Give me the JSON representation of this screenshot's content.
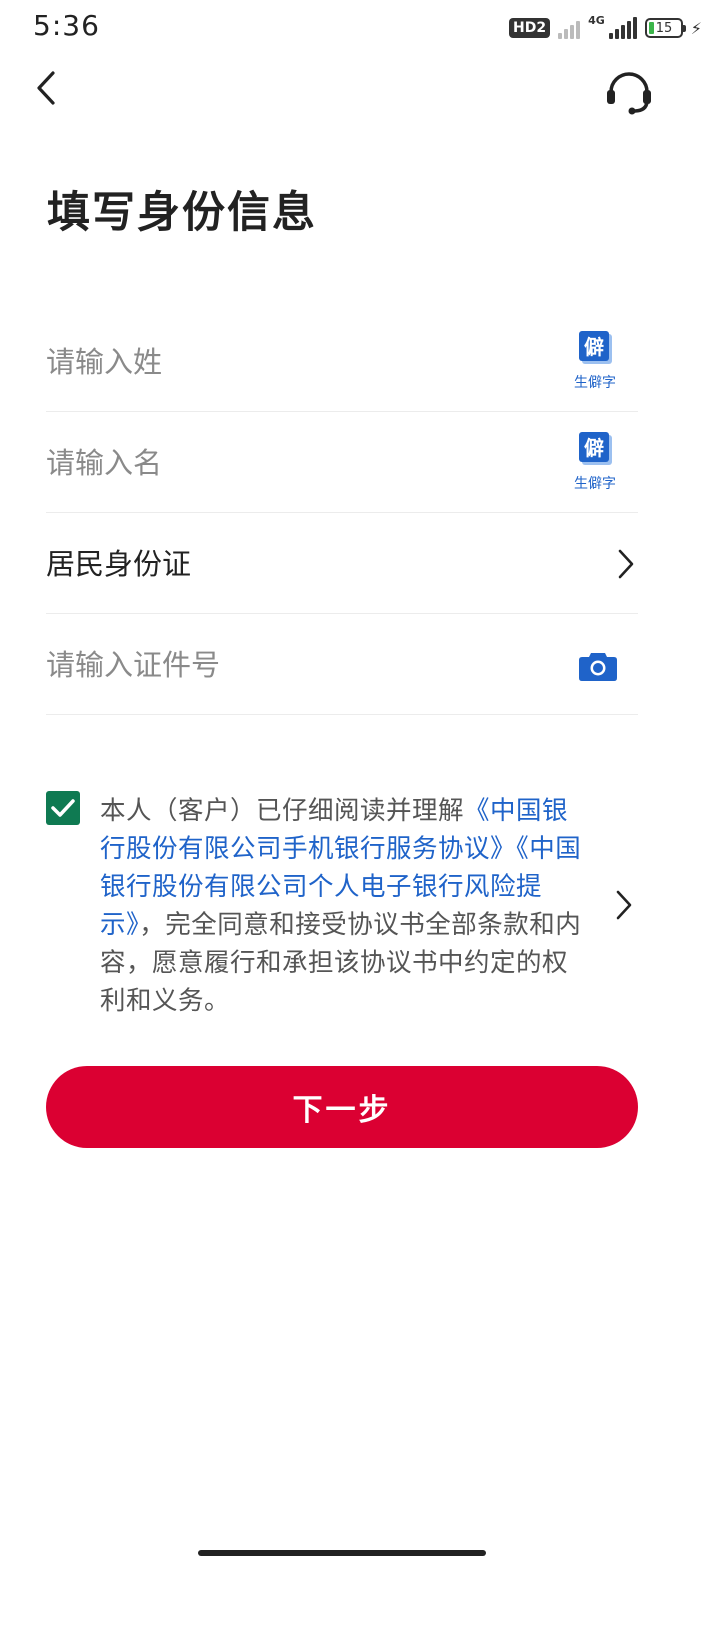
{
  "status_bar": {
    "time": "5:36",
    "hd_badge": "HD2",
    "network": "4G",
    "battery": "15"
  },
  "header": {
    "back_icon": "chevron-left-icon",
    "support_icon": "headset-icon"
  },
  "page": {
    "title": "填写身份信息"
  },
  "form": {
    "surname": {
      "placeholder": "请输入姓",
      "rare_char_label": "生僻字",
      "rare_char_glyph": "僻"
    },
    "given_name": {
      "placeholder": "请输入名",
      "rare_char_label": "生僻字",
      "rare_char_glyph": "僻"
    },
    "id_type": {
      "value": "居民身份证"
    },
    "id_number": {
      "placeholder": "请输入证件号",
      "scan_icon": "camera-icon"
    }
  },
  "agreement": {
    "checked": true,
    "text_prefix": "本人（客户）已仔细阅读并理解",
    "link_1": "《中国银行股份有限公司手机银行服务协议》",
    "link_2": "《中国银行股份有限公司个人电子银行风险提示》",
    "text_suffix": "，完全同意和接受协议书全部条款和内容，愿意履行和承担该协议书中约定的权利和义务。"
  },
  "actions": {
    "next_label": "下一步"
  },
  "colors": {
    "primary_red": "#db0032",
    "link_blue": "#1f63c9",
    "checkbox_green": "#0f7a52"
  }
}
